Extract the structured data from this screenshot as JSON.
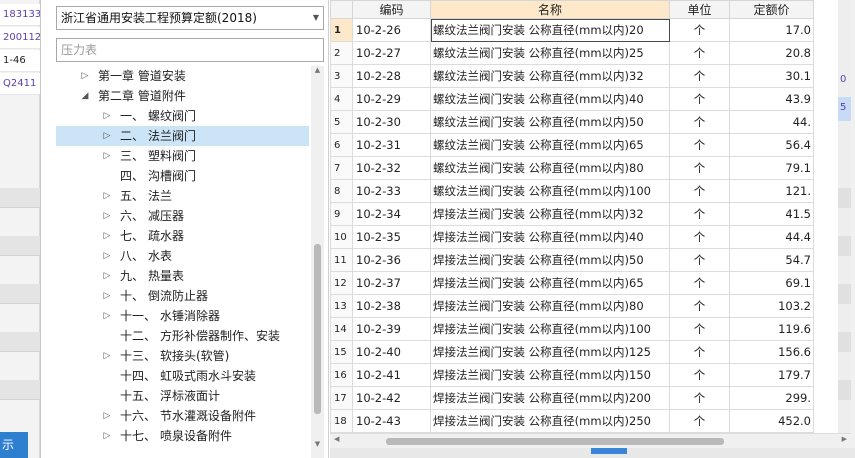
{
  "background_left": {
    "rows": [
      "183133",
      "200112",
      "1-46",
      "Q2411"
    ],
    "bottom_button": "示"
  },
  "background_right": {
    "numbers": [
      "0",
      "5"
    ]
  },
  "left_pane": {
    "quota_select": "浙江省通用安装工程预算定额(2018)",
    "search_placeholder": "压力表",
    "tree": [
      {
        "label": "第一章 管道安装",
        "level": 0,
        "state": "collapsed"
      },
      {
        "label": "第二章 管道附件",
        "level": 0,
        "state": "expanded"
      },
      {
        "num": "一、",
        "label": "螺纹阀门",
        "level": 1,
        "state": "collapsed"
      },
      {
        "num": "二、",
        "label": "法兰阀门",
        "level": 1,
        "state": "collapsed",
        "selected": true
      },
      {
        "num": "三、",
        "label": "塑料阀门",
        "level": 1,
        "state": "collapsed"
      },
      {
        "num": "四、",
        "label": "沟槽阀门",
        "level": 1,
        "state": "leaf"
      },
      {
        "num": "五、",
        "label": "法兰",
        "level": 1,
        "state": "collapsed"
      },
      {
        "num": "六、",
        "label": "减压器",
        "level": 1,
        "state": "collapsed"
      },
      {
        "num": "七、",
        "label": "疏水器",
        "level": 1,
        "state": "collapsed"
      },
      {
        "num": "八、",
        "label": "水表",
        "level": 1,
        "state": "collapsed"
      },
      {
        "num": "九、",
        "label": "热量表",
        "level": 1,
        "state": "collapsed"
      },
      {
        "num": "十、",
        "label": "倒流防止器",
        "level": 1,
        "state": "collapsed"
      },
      {
        "num": "十一、",
        "label": "水锤消除器",
        "level": 1,
        "state": "collapsed"
      },
      {
        "num": "十二、",
        "label": "方形补偿器制作、安装",
        "level": 1,
        "state": "leaf"
      },
      {
        "num": "十三、",
        "label": "软接头(软管)",
        "level": 1,
        "state": "collapsed"
      },
      {
        "num": "十四、",
        "label": "虹吸式雨水斗安装",
        "level": 1,
        "state": "leaf"
      },
      {
        "num": "十五、",
        "label": "浮标液面计",
        "level": 1,
        "state": "leaf"
      },
      {
        "num": "十六、",
        "label": "节水灌溉设备附件",
        "level": 1,
        "state": "collapsed"
      },
      {
        "num": "十七、",
        "label": "喷泉设备附件",
        "level": 1,
        "state": "collapsed"
      }
    ]
  },
  "grid": {
    "headers": {
      "code": "编码",
      "name": "名称",
      "unit": "单位",
      "price": "定额价"
    },
    "current_row": 1,
    "rows": [
      {
        "idx": "1",
        "code": "10-2-26",
        "name": "螺纹法兰阀门安装 公称直径(mm以内)20",
        "unit": "个",
        "price": "17.0"
      },
      {
        "idx": "2",
        "code": "10-2-27",
        "name": "螺纹法兰阀门安装 公称直径(mm以内)25",
        "unit": "个",
        "price": "20.8"
      },
      {
        "idx": "3",
        "code": "10-2-28",
        "name": "螺纹法兰阀门安装 公称直径(mm以内)32",
        "unit": "个",
        "price": "30.1"
      },
      {
        "idx": "4",
        "code": "10-2-29",
        "name": "螺纹法兰阀门安装 公称直径(mm以内)40",
        "unit": "个",
        "price": "43.9"
      },
      {
        "idx": "5",
        "code": "10-2-30",
        "name": "螺纹法兰阀门安装 公称直径(mm以内)50",
        "unit": "个",
        "price": "44."
      },
      {
        "idx": "6",
        "code": "10-2-31",
        "name": "螺纹法兰阀门安装 公称直径(mm以内)65",
        "unit": "个",
        "price": "56.4"
      },
      {
        "idx": "7",
        "code": "10-2-32",
        "name": "螺纹法兰阀门安装 公称直径(mm以内)80",
        "unit": "个",
        "price": "79.1"
      },
      {
        "idx": "8",
        "code": "10-2-33",
        "name": "螺纹法兰阀门安装 公称直径(mm以内)100",
        "unit": "个",
        "price": "121."
      },
      {
        "idx": "9",
        "code": "10-2-34",
        "name": "焊接法兰阀门安装 公称直径(mm以内)32",
        "unit": "个",
        "price": "41.5"
      },
      {
        "idx": "10",
        "code": "10-2-35",
        "name": "焊接法兰阀门安装 公称直径(mm以内)40",
        "unit": "个",
        "price": "44.4"
      },
      {
        "idx": "11",
        "code": "10-2-36",
        "name": "焊接法兰阀门安装 公称直径(mm以内)50",
        "unit": "个",
        "price": "54.7"
      },
      {
        "idx": "12",
        "code": "10-2-37",
        "name": "焊接法兰阀门安装 公称直径(mm以内)65",
        "unit": "个",
        "price": "69.1"
      },
      {
        "idx": "13",
        "code": "10-2-38",
        "name": "焊接法兰阀门安装 公称直径(mm以内)80",
        "unit": "个",
        "price": "103.2"
      },
      {
        "idx": "14",
        "code": "10-2-39",
        "name": "焊接法兰阀门安装 公称直径(mm以内)100",
        "unit": "个",
        "price": "119.6"
      },
      {
        "idx": "15",
        "code": "10-2-40",
        "name": "焊接法兰阀门安装 公称直径(mm以内)125",
        "unit": "个",
        "price": "156.6"
      },
      {
        "idx": "16",
        "code": "10-2-41",
        "name": "焊接法兰阀门安装 公称直径(mm以内)150",
        "unit": "个",
        "price": "179.7"
      },
      {
        "idx": "17",
        "code": "10-2-42",
        "name": "焊接法兰阀门安装 公称直径(mm以内)200",
        "unit": "个",
        "price": "299."
      },
      {
        "idx": "18",
        "code": "10-2-43",
        "name": "焊接法兰阀门安装 公称直径(mm以内)250",
        "unit": "个",
        "price": "452.0"
      }
    ]
  },
  "colors": {
    "selection": "#cce4f7",
    "header_highlight": "#fde9c9",
    "accent_blue": "#3a86d6"
  }
}
